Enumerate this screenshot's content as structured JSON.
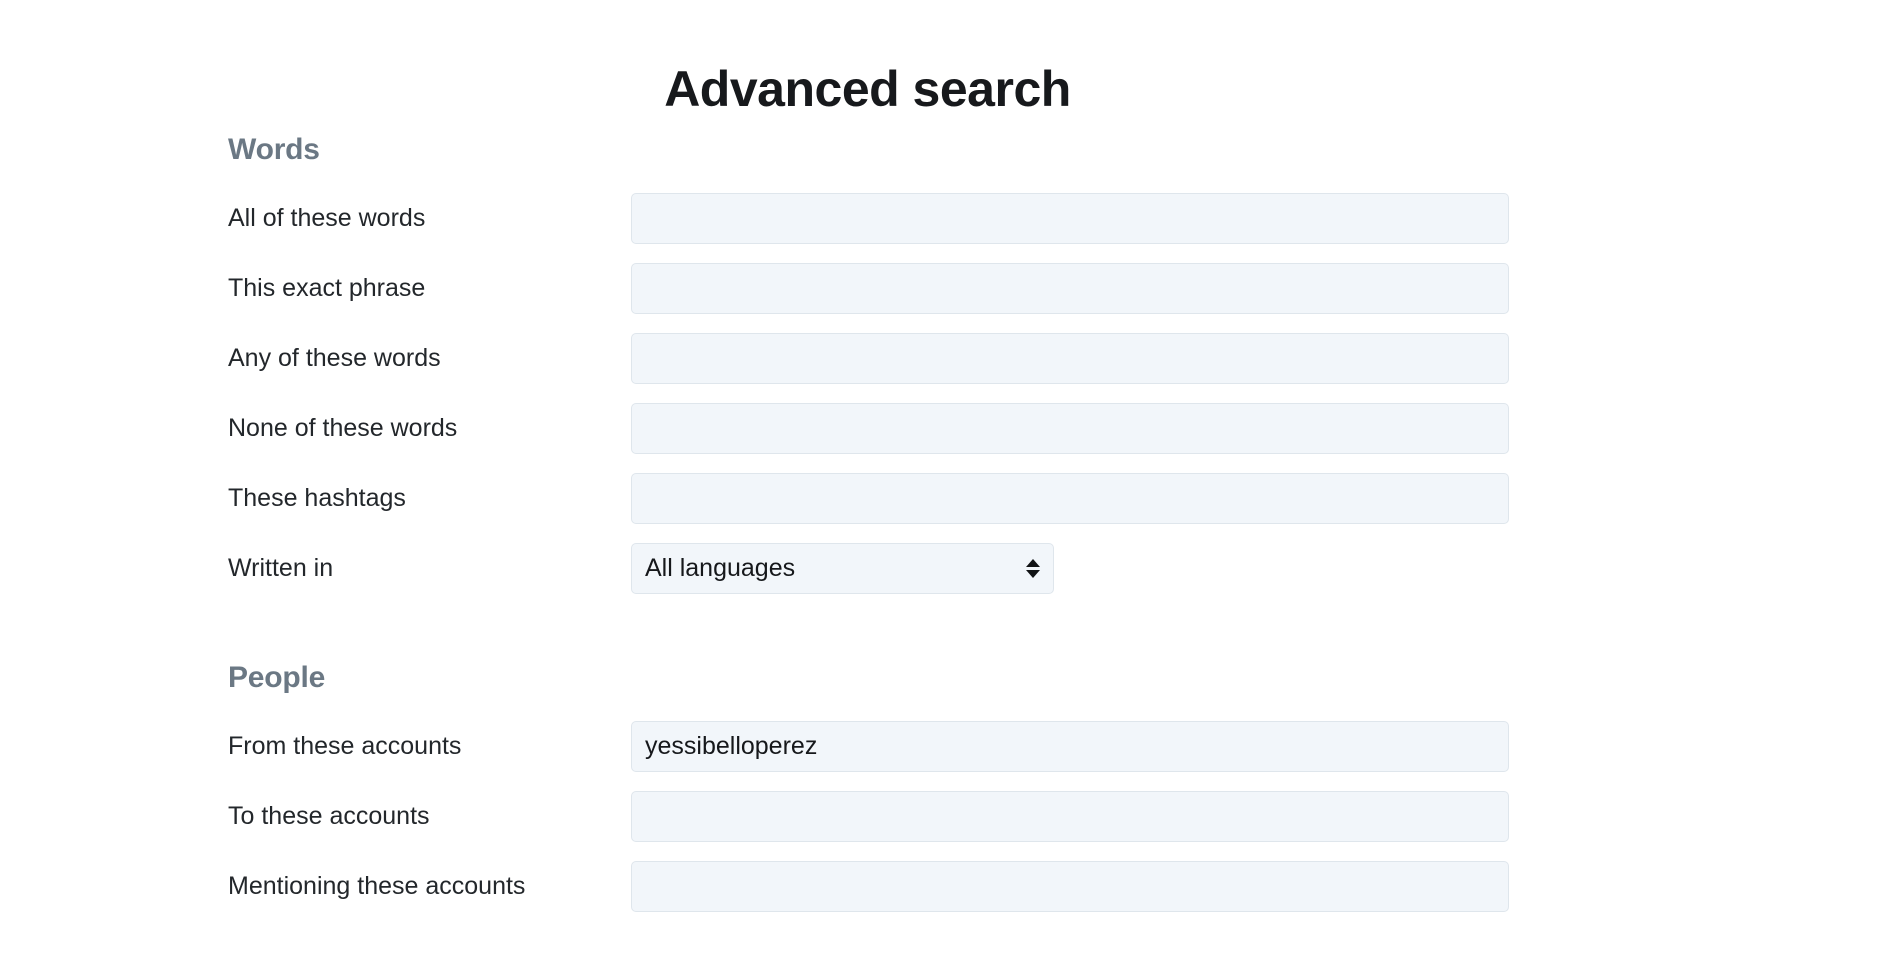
{
  "page": {
    "title": "Advanced search"
  },
  "sections": [
    {
      "id": "words",
      "heading": "Words",
      "fields": [
        {
          "label": "All of these words",
          "type": "text",
          "value": "",
          "placeholder": ""
        },
        {
          "label": "This exact phrase",
          "type": "text",
          "value": "",
          "placeholder": ""
        },
        {
          "label": "Any of these words",
          "type": "text",
          "value": "",
          "placeholder": ""
        },
        {
          "label": "None of these words",
          "type": "text",
          "value": "",
          "placeholder": ""
        },
        {
          "label": "These hashtags",
          "type": "text",
          "value": "",
          "placeholder": ""
        },
        {
          "label": "Written in",
          "type": "select",
          "value": "All languages",
          "options": [
            "All languages"
          ]
        }
      ]
    },
    {
      "id": "people",
      "heading": "People",
      "fields": [
        {
          "label": "From these accounts",
          "type": "text",
          "value": "yessibelloperez",
          "placeholder": ""
        },
        {
          "label": "To these accounts",
          "type": "text",
          "value": "",
          "placeholder": ""
        },
        {
          "label": "Mentioning these accounts",
          "type": "text",
          "value": "",
          "placeholder": ""
        }
      ]
    }
  ],
  "icons": {
    "select_arrow_up": "triangle-up-icon",
    "select_arrow_down": "triangle-down-icon"
  },
  "colors": {
    "title_text": "#17191c",
    "section_heading": "#6b7884",
    "label_text": "#23272b",
    "input_background": "#f2f6fa",
    "input_border": "#dfe6ec",
    "page_background": "#ffffff"
  }
}
